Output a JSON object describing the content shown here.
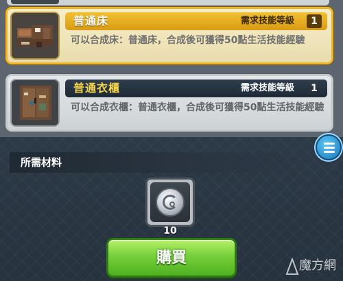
{
  "recipes": [
    {
      "name": "普通床",
      "requirement_label": "需求技能等級",
      "requirement_level": "1",
      "description": "可以合成床：普通床，合成後可獲得50點生活技能經驗",
      "selected": true
    },
    {
      "name": "普通衣櫃",
      "requirement_label": "需求技能等級",
      "requirement_level": "1",
      "description": "可以合成衣櫃：普通衣櫃，合成後可獲得50點生活技能經驗",
      "selected": false
    }
  ],
  "materials": {
    "title": "所需材料",
    "items": [
      {
        "icon": "silver-coin-icon",
        "quantity": "10"
      }
    ]
  },
  "buy_button": {
    "label": "購買"
  },
  "watermark": {
    "text": "魔方網"
  },
  "colors": {
    "selected_border": "#f0b62a",
    "buy_green": "#76d03a",
    "menu_blue": "#1877b8"
  }
}
